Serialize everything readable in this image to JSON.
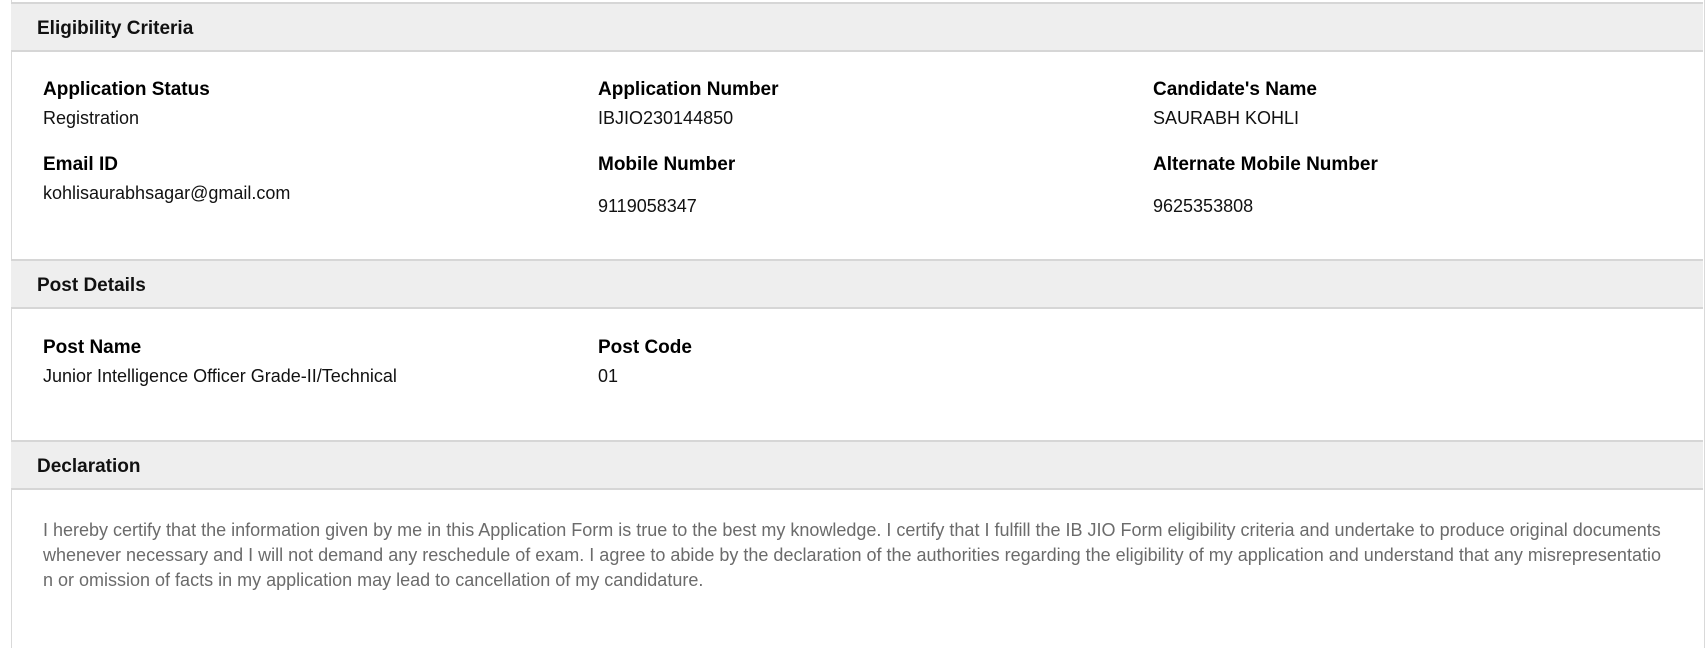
{
  "eligibility": {
    "title": "Eligibility Criteria",
    "application_status": {
      "label": "Application Status",
      "value": "Registration"
    },
    "application_number": {
      "label": "Application Number",
      "value": "IBJIO230144850"
    },
    "candidate_name": {
      "label": "Candidate's Name",
      "value": "SAURABH KOHLI"
    },
    "email_id": {
      "label": "Email ID",
      "value": "kohlisaurabhsagar@gmail.com"
    },
    "mobile_number": {
      "label": "Mobile Number",
      "value": "9119058347"
    },
    "alternate_mobile_number": {
      "label": "Alternate Mobile Number",
      "value": "9625353808"
    }
  },
  "post_details": {
    "title": "Post Details",
    "post_name": {
      "label": "Post Name",
      "value": "Junior Intelligence Officer Grade-II/Technical"
    },
    "post_code": {
      "label": "Post Code",
      "value": "01"
    }
  },
  "declaration": {
    "title": "Declaration",
    "text": "I hereby certify that the information given by me in this Application Form is true to the best my knowledge. I certify that I fulfill the IB JIO Form eligibility criteria and undertake to produce original documents whenever necessary and I will not demand any reschedule of exam. I agree to abide by the declaration of the authorities regarding the eligibility of my application and understand that any misrepresentation or omission of facts in my application may lead to cancellation of my candidature."
  }
}
